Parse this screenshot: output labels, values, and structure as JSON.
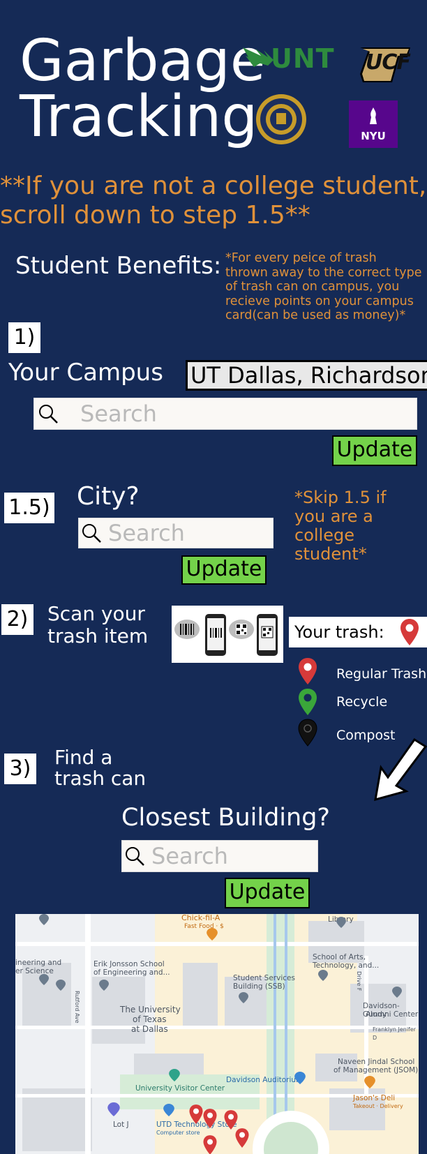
{
  "header": {
    "title_line1": "Garbage",
    "title_line2": "Tracking",
    "logos": {
      "unt": "UNT",
      "ucf": "UCF",
      "nyu": "NYU"
    }
  },
  "notice": {
    "line1": "**If you are not a college student,",
    "line2": "scroll down to step 1.5**"
  },
  "benefits": {
    "label": "Student Benefits:",
    "text": "*For every peice of trash thrown away to the correct type of trash can on campus, you recieve points on your campus card(can be used as money)*"
  },
  "step1": {
    "number": "1)",
    "label": "Your Campus",
    "campus_value": "UT Dallas, Richardson",
    "search_placeholder": "Search",
    "update_label": "Update"
  },
  "step15": {
    "number": "1.5)",
    "label": "City?",
    "search_placeholder": "Search",
    "update_label": "Update",
    "note": "*Skip 1.5 if you are a college student*"
  },
  "step2": {
    "number": "2)",
    "label_line1": "Scan your",
    "label_line2": "trash item",
    "your_trash_label": "Your trash:",
    "legend": [
      {
        "label": "Regular Trash",
        "color": "#d63a3a"
      },
      {
        "label": "Recycle",
        "color": "#3aa63a"
      },
      {
        "label": "Compost",
        "color": "#111111"
      }
    ]
  },
  "step3": {
    "number": "3)",
    "label_line1": "Find a",
    "label_line2": "trash can",
    "closest_label": "Closest Building?",
    "search_placeholder": "Search",
    "update_label": "Update"
  },
  "map": {
    "labels": {
      "chick": "Chick-fil-A",
      "chick_sub": "Fast Food · $",
      "library": "Library",
      "eng1": "ineering and",
      "eng2": "er Science",
      "jonsson1": "Erik Jonsson School",
      "jonsson2": "of Engineering and...",
      "rutford": "Rutford Ave",
      "arts1": "School of Arts,",
      "arts2": "Technology, and...",
      "ssb1": "Student Services",
      "ssb2": "Building (SSB)",
      "drive": "Drive F",
      "utd1": "The University",
      "utd2": "of Texas",
      "utd3": "at Dallas",
      "dg1": "Davidson-Gundy",
      "dg2": "Alumni Center",
      "franklyn": "Franklyn Jenifer D",
      "jindal1": "Naveen Jindal School",
      "jindal2": "of Management (JSOM)",
      "visitor": "University Visitor Center",
      "aud": "Davidson Auditorium",
      "jason": "Jason's Deli",
      "jason_sub": "Takeout · Delivery",
      "lotj": "Lot J",
      "store1": "UTD Technology Store",
      "store2": "Computer store"
    }
  },
  "colors": {
    "background": "#152a56",
    "accent_orange": "#e0913a",
    "update_green": "#74d24a"
  }
}
